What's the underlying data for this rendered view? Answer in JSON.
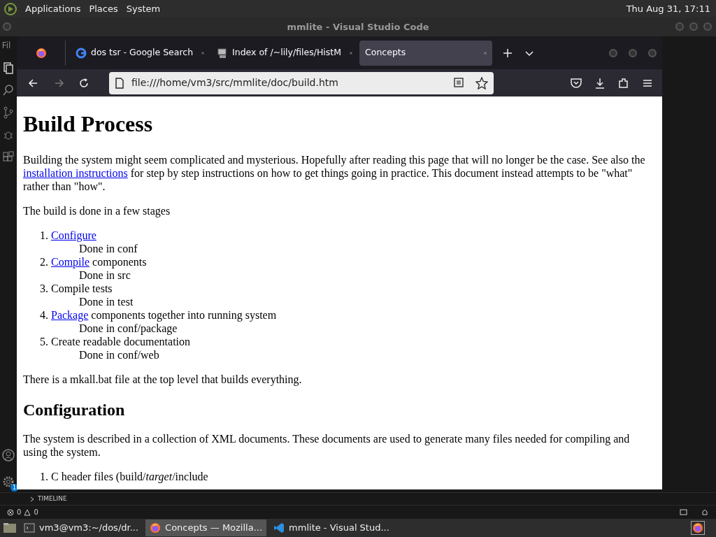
{
  "top_panel": {
    "menus": [
      "Applications",
      "Places",
      "System"
    ],
    "clock": "Thu Aug 31, 17:11"
  },
  "editor_window": {
    "title": "mmlite - Visual Studio Code",
    "menu_fragment": "Fil",
    "timeline": "TIMELINE",
    "errors": "0",
    "warnings": "0",
    "settings_badge": "1"
  },
  "browser": {
    "tabs": [
      {
        "label": "dos tsr - Google Search",
        "kind": "google",
        "selected": false
      },
      {
        "label": "Index of /~lily/files/HistM",
        "kind": "computer",
        "selected": false
      },
      {
        "label": "Concepts",
        "kind": "plain",
        "selected": true
      }
    ],
    "url": "file:///home/vm3/src/mmlite/doc/build.htm",
    "page": [
      {
        "kind": "h1",
        "text": "Build Process"
      },
      {
        "kind": "p",
        "parts": [
          {
            "text": "Building the system might seem complicated and mysterious. Hopefully after reading this page that will no longer be the case. See also the "
          },
          {
            "text": "installation instructions",
            "link": true
          },
          {
            "text": " for step by step instructions on how to get things going in practice. This document instead attempts to be \"what\" rather than \"how\"."
          }
        ]
      },
      {
        "kind": "p",
        "parts": [
          {
            "text": "The build is done in a few stages"
          }
        ]
      },
      {
        "kind": "ol",
        "items": [
          {
            "marker": "1.",
            "parts": [
              {
                "text": "Configure",
                "link": true
              }
            ],
            "detail": "Done in conf"
          },
          {
            "marker": "2.",
            "parts": [
              {
                "text": "Compile",
                "link": true
              },
              {
                "text": " components"
              }
            ],
            "detail": "Done in src"
          },
          {
            "marker": "3.",
            "parts": [
              {
                "text": "Compile tests"
              }
            ],
            "detail": "Done in test"
          },
          {
            "marker": "4.",
            "parts": [
              {
                "text": "Package",
                "link": true
              },
              {
                "text": " components together into running system"
              }
            ],
            "detail": "Done in conf/package"
          },
          {
            "marker": "5.",
            "parts": [
              {
                "text": "Create readable documentation"
              }
            ],
            "detail": "Done in conf/web"
          }
        ]
      },
      {
        "kind": "p",
        "parts": [
          {
            "text": "There is a mkall.bat file at the top level that builds everything."
          }
        ]
      },
      {
        "kind": "h2",
        "text": "Configuration"
      },
      {
        "kind": "p",
        "parts": [
          {
            "text": "The system is described in a collection of XML documents. These documents are used to generate many files needed for compiling and using the system."
          }
        ]
      },
      {
        "kind": "ol",
        "items": [
          {
            "marker": "1.",
            "parts": [
              {
                "text": "C header files (build/*target*/include"
              }
            ]
          }
        ]
      }
    ]
  },
  "taskbar": {
    "items": [
      {
        "label": "vm3@vm3:~/dos/dr...",
        "kind": "terminal",
        "selected": false
      },
      {
        "label": "Concepts — Mozilla...",
        "kind": "firefox",
        "selected": true
      },
      {
        "label": "mmlite - Visual Stud...",
        "kind": "vscode",
        "selected": false
      }
    ]
  }
}
